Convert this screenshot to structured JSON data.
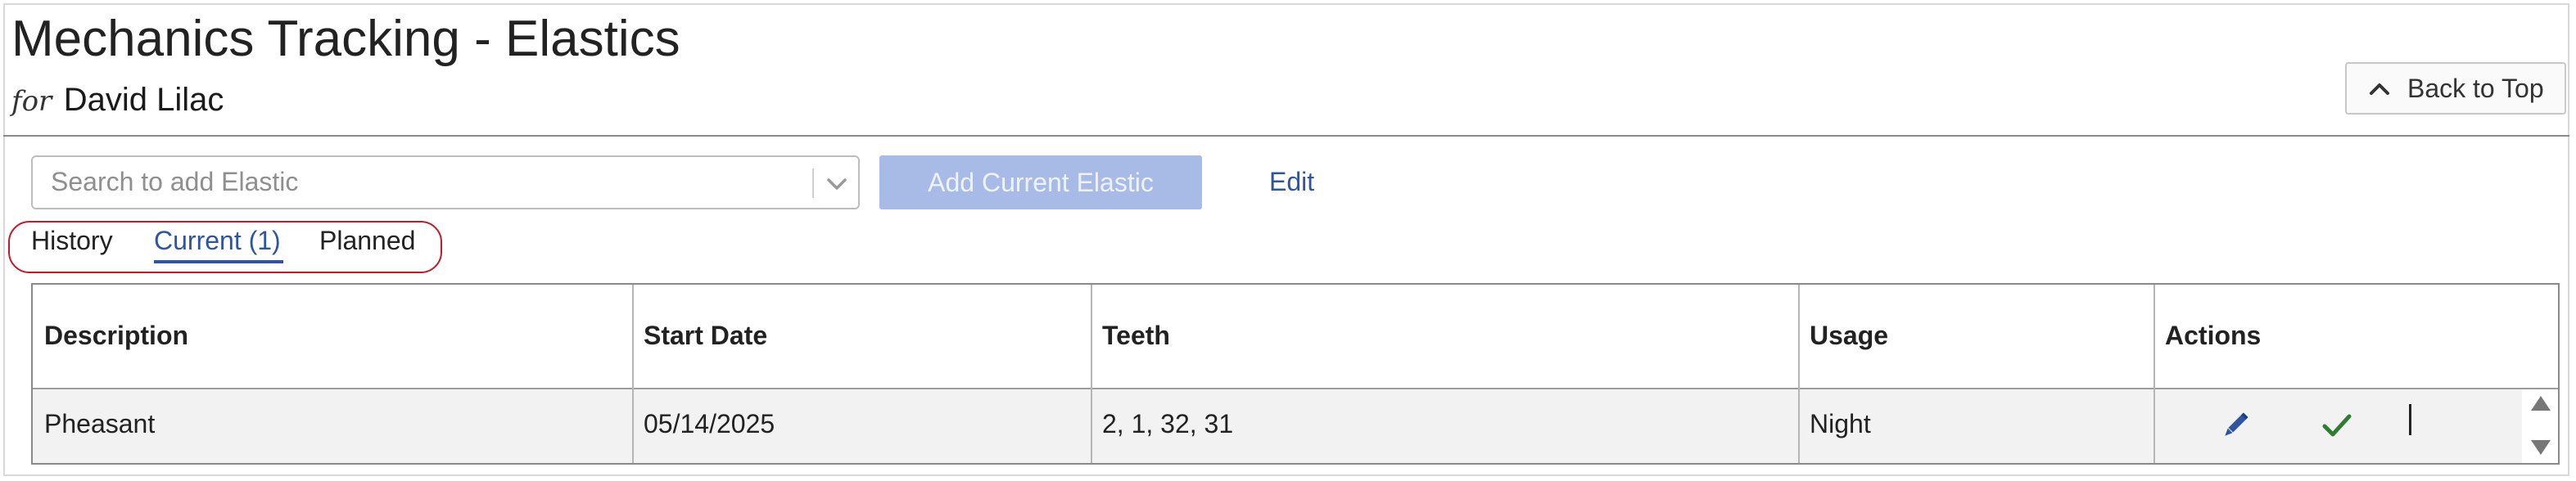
{
  "header": {
    "title": "Mechanics Tracking - Elastics",
    "for_label": "for",
    "patient_name": "David Lilac",
    "back_to_top_label": "Back to Top"
  },
  "toolbar": {
    "search_placeholder": "Search to add Elastic",
    "add_button_label": "Add Current Elastic",
    "edit_link_label": "Edit"
  },
  "tabs": [
    {
      "label": "History",
      "active": false
    },
    {
      "label": "Current (1)",
      "active": true
    },
    {
      "label": "Planned",
      "active": false
    }
  ],
  "table": {
    "columns": [
      "Description",
      "Start Date",
      "Teeth",
      "Usage",
      "Actions"
    ],
    "rows": [
      {
        "description": "Pheasant",
        "start_date": "05/14/2025",
        "teeth": "2, 1, 32, 31",
        "usage": "Night"
      }
    ],
    "action_icons": [
      "pencil-icon",
      "checkmark-icon"
    ]
  },
  "colors": {
    "accent": "#2f55a0",
    "add_button_disabled": "#a8bbe6",
    "tab_highlight": "#c4192c",
    "checkmark": "#2e7d32",
    "row_background": "#f2f2f3"
  }
}
